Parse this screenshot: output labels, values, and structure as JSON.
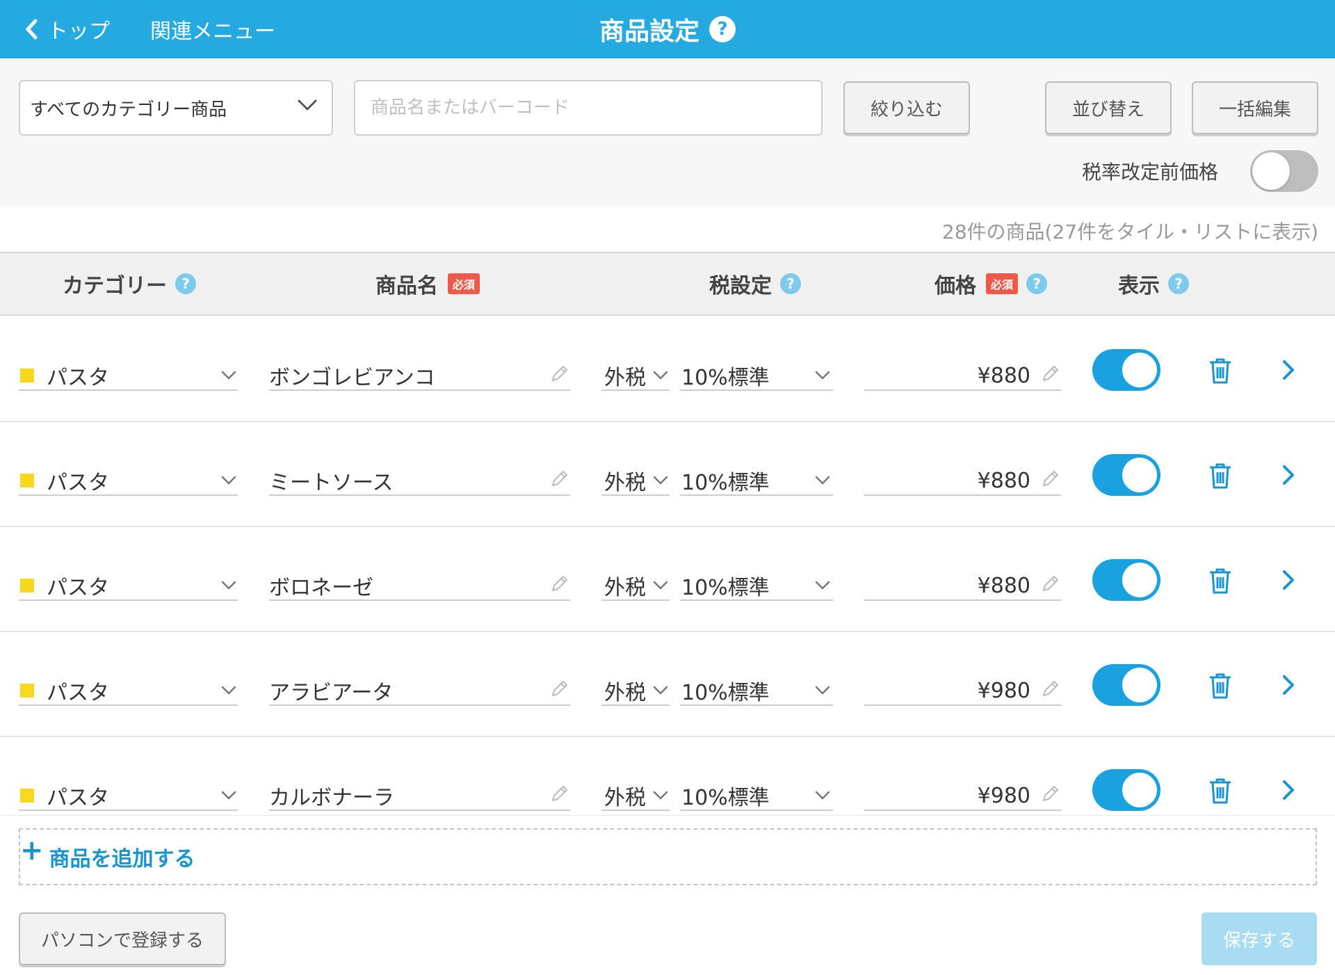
{
  "header": {
    "back_label": "トップ",
    "related_menu_label": "関連メニュー",
    "title": "商品設定",
    "help_label": "?"
  },
  "toolbar": {
    "category_select_value": "すべてのカテゴリー商品",
    "search_placeholder": "商品名またはバーコード",
    "filter_label": "絞り込む",
    "sort_label": "並び替え",
    "bulk_edit_label": "一括編集",
    "tax_revision_label": "税率改定前価格",
    "tax_revision_enabled": false
  },
  "count_text": "28件の商品(27件をタイル・リストに表示)",
  "columns": {
    "category": "カテゴリー",
    "name": "商品名",
    "tax": "税設定",
    "price": "価格",
    "display": "表示",
    "required_badge": "必須",
    "help": "?"
  },
  "rows": [
    {
      "category": "パスタ",
      "name": "ボンゴレビアンコ",
      "tax_type": "外税",
      "tax_rate": "10%標準",
      "price": "¥880",
      "visible": true
    },
    {
      "category": "パスタ",
      "name": "ミートソース",
      "tax_type": "外税",
      "tax_rate": "10%標準",
      "price": "¥880",
      "visible": true
    },
    {
      "category": "パスタ",
      "name": "ボロネーゼ",
      "tax_type": "外税",
      "tax_rate": "10%標準",
      "price": "¥880",
      "visible": true
    },
    {
      "category": "パスタ",
      "name": "アラビアータ",
      "tax_type": "外税",
      "tax_rate": "10%標準",
      "price": "¥980",
      "visible": true
    },
    {
      "category": "パスタ",
      "name": "カルボナーラ",
      "tax_type": "外税",
      "tax_rate": "10%標準",
      "price": "¥980",
      "visible": true
    }
  ],
  "add_product": {
    "plus": "+",
    "label": "商品を追加する"
  },
  "footer": {
    "pc_register_label": "パソコンで登録する",
    "save_label": "保存する"
  },
  "colors": {
    "primary": "#24a9e1",
    "toggle_on": "#1aa2e0",
    "category_swatch": "#f8d81e",
    "required": "#ee5a4a",
    "save_disabled": "#a9dcf2"
  }
}
